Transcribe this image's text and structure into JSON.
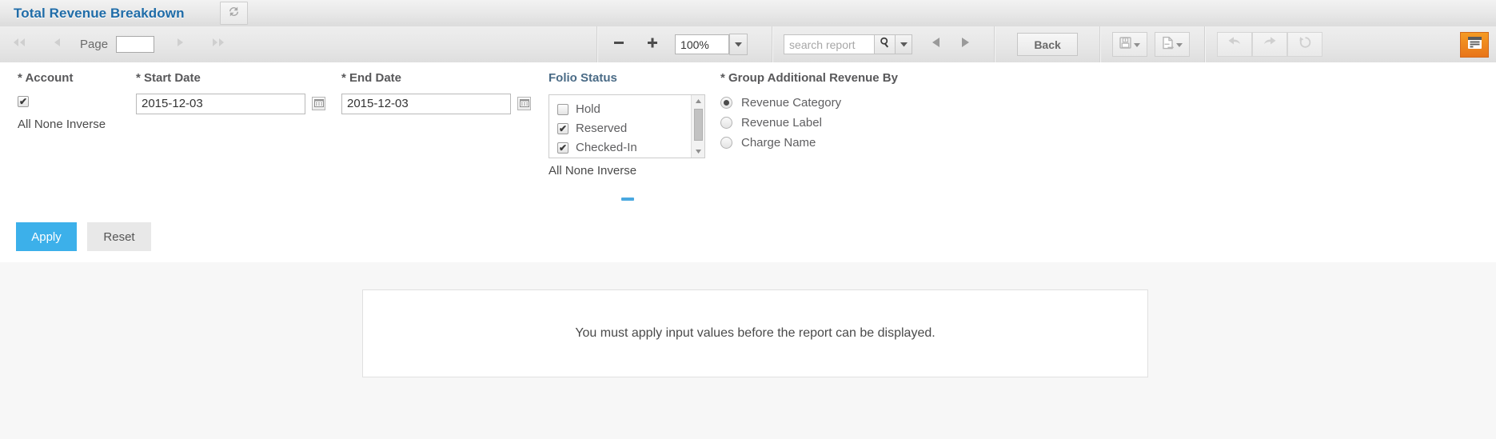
{
  "window": {
    "title": "Total Revenue Breakdown",
    "refresh_icon": "refresh-icon"
  },
  "toolbar": {
    "first_page_icon": "first-page-icon",
    "prev_page_icon": "prev-page-icon",
    "page_label": "Page",
    "page_value": "",
    "next_page_icon": "next-page-icon",
    "last_page_icon": "last-page-icon",
    "zoom_out_icon": "minus-icon",
    "zoom_in_icon": "plus-icon",
    "zoom_value": "100%",
    "zoom_caret_icon": "chevron-down-icon",
    "search_placeholder": "search report",
    "search_value": "",
    "search_icon": "magnifier-icon",
    "search_caret_icon": "chevron-down-icon",
    "search_prev_icon": "triangle-left-icon",
    "search_next_icon": "triangle-right-icon",
    "back_label": "Back",
    "save_icon": "floppy-disk-icon",
    "save_caret_icon": "chevron-down-icon",
    "export_icon": "export-document-icon",
    "export_caret_icon": "chevron-down-icon",
    "undo_icon": "undo-arrow-icon",
    "redo_icon": "redo-arrow-icon",
    "reset_icon": "reset-circular-arrow-icon",
    "panel_toggle_icon": "parameters-panel-icon",
    "accent_orange": "#ec7d1c"
  },
  "params": {
    "account": {
      "label": "* Account",
      "checked": true,
      "check_glyph": "✔",
      "select_links": "All None Inverse"
    },
    "start_date": {
      "label": "* Start Date",
      "value": "2015-12-03",
      "calendar_icon": "calendar-icon"
    },
    "end_date": {
      "label": "* End Date",
      "value": "2015-12-03",
      "calendar_icon": "calendar-icon"
    },
    "folio_status": {
      "label": "Folio Status",
      "items": [
        {
          "label": "Hold",
          "checked": false
        },
        {
          "label": "Reserved",
          "checked": true
        },
        {
          "label": "Checked-In",
          "checked": true
        }
      ],
      "check_glyph": "✔",
      "select_links": "All None Inverse",
      "scroll_up_icon": "scroll-up-arrow-icon",
      "scroll_down_icon": "scroll-down-arrow-icon"
    },
    "group_by": {
      "label": "* Group Additional Revenue By",
      "options": [
        {
          "label": "Revenue Category",
          "selected": true
        },
        {
          "label": "Revenue Label",
          "selected": false
        },
        {
          "label": "Charge Name",
          "selected": false
        }
      ]
    },
    "collapse_handle": "collapse-panel-handle",
    "apply_label": "Apply",
    "reset_label": "Reset",
    "apply_color": "#3cb0ea"
  },
  "report": {
    "message": "You must apply input values before the report can be displayed."
  }
}
